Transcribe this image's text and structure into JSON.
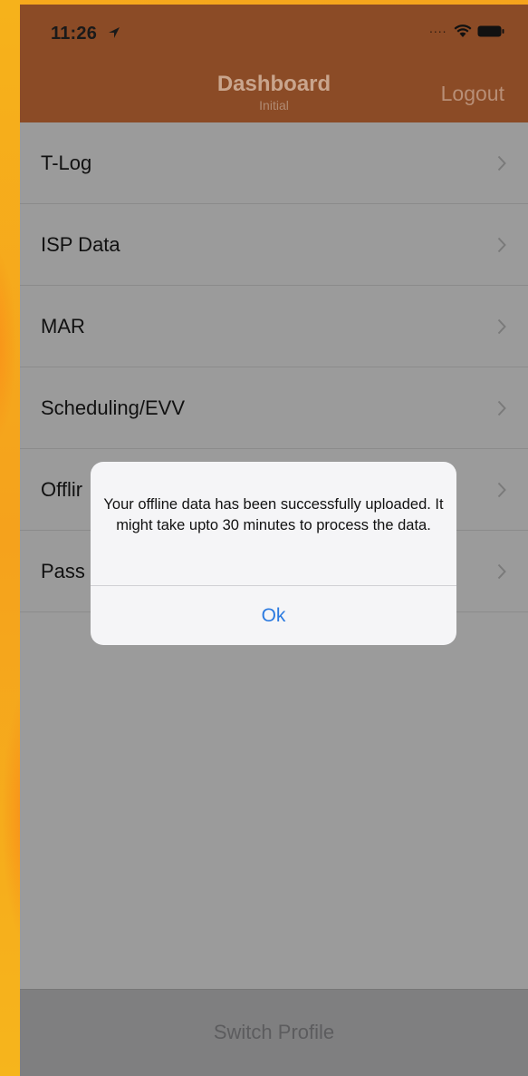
{
  "status_bar": {
    "time": "11:26",
    "signal": "....",
    "icons": [
      "location-arrow-icon",
      "wifi-icon",
      "battery-icon"
    ]
  },
  "navbar": {
    "title": "Dashboard",
    "subtitle": "Initial",
    "logout_label": "Logout"
  },
  "menu": {
    "items": [
      {
        "label": "T-Log"
      },
      {
        "label": "ISP Data"
      },
      {
        "label": "MAR"
      },
      {
        "label": "Scheduling/EVV"
      },
      {
        "label": "Offlir"
      },
      {
        "label": "Pass"
      }
    ]
  },
  "alert": {
    "message": "Your offline data has been successfully uploaded. It might take upto 30 minutes to process the data.",
    "ok_label": "Ok"
  },
  "footer": {
    "switch_profile_label": "Switch Profile"
  },
  "colors": {
    "navbar_bg": "#8b4b26",
    "overlay_bg": "#9b9b9b",
    "alert_button": "#2b7ae0",
    "frame_orange": "#f39a1d"
  }
}
